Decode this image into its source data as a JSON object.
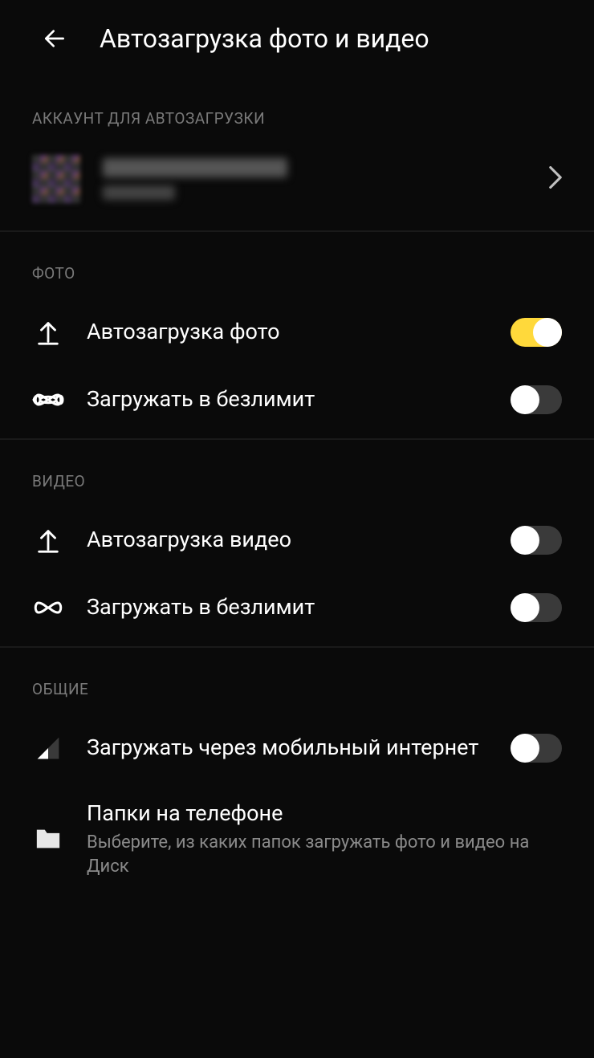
{
  "header": {
    "title": "Автозагрузка фото и видео"
  },
  "sections": {
    "account": {
      "header": "АККАУНТ ДЛЯ АВТОЗАГРУЗКИ"
    },
    "photo": {
      "header": "ФОТО",
      "auto_upload": {
        "label": "Автозагрузка фото",
        "on": true
      },
      "unlimited": {
        "label": "Загружать в безлимит",
        "on": false
      }
    },
    "video": {
      "header": "ВИДЕО",
      "auto_upload": {
        "label": "Автозагрузка видео",
        "on": false
      },
      "unlimited": {
        "label": "Загружать в безлимит",
        "on": false
      }
    },
    "general": {
      "header": "ОБЩИЕ",
      "mobile_data": {
        "label": "Загружать через мобильный интернет",
        "on": false
      },
      "folders": {
        "label": "Папки на телефоне",
        "sub": "Выберите, из каких папок загружать фото и видео на Диск"
      }
    }
  }
}
